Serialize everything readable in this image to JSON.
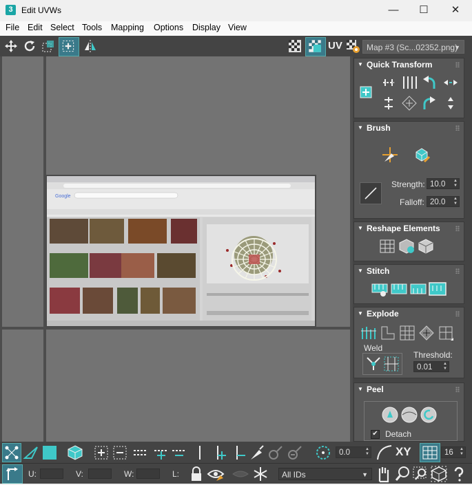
{
  "window": {
    "title": "Edit UVWs",
    "app_icon": "3",
    "minimize": "—",
    "maximize": "☐",
    "close": "✕"
  },
  "menu": [
    "File",
    "Edit",
    "Select",
    "Tools",
    "Mapping",
    "Options",
    "Display",
    "View"
  ],
  "toolbar": {
    "uv_label": "UV",
    "map_select": "Map #3 (Sc...02352.png)"
  },
  "panel": {
    "quick_transform": "Quick Transform",
    "brush": "Brush",
    "strength_label": "Strength:",
    "strength_value": "10.0",
    "falloff_label": "Falloff:",
    "falloff_value": "20.0",
    "reshape": "Reshape Elements",
    "stitch": "Stitch",
    "explode": "Explode",
    "weld_label": "Weld",
    "threshold_label": "Threshold:",
    "threshold_value": "0.01",
    "peel": "Peel",
    "detach_label": "Detach",
    "detach_checked": "✔"
  },
  "bottom": {
    "rotate_value": "0.0",
    "xy_label": "XY",
    "spinner_16": "16",
    "u_label": "U:",
    "v_label": "V:",
    "w_label": "W:",
    "l_label": "L:",
    "ids_select": "All IDs"
  },
  "colors": {
    "accent": "#3fc8c8",
    "panel_bg": "#444444",
    "rollout_bg": "#575757",
    "viewport_bg": "#737373"
  }
}
